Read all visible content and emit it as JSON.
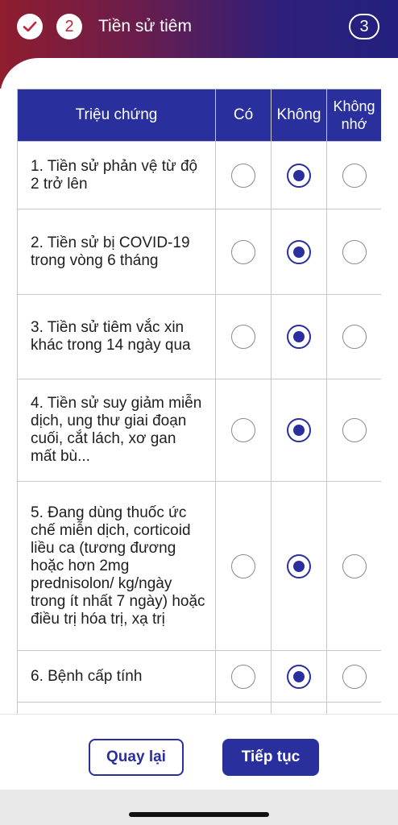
{
  "header": {
    "step_current_number": "2",
    "title": "Tiền sử tiêm",
    "step_next_number": "3"
  },
  "table": {
    "headers": {
      "symptom": "Triệu chứng",
      "yes": "Có",
      "no": "Không",
      "dont_remember": "Không nhớ"
    },
    "rows": [
      {
        "label": "1. Tiền sử phản vệ từ độ 2 trở lên",
        "selected": "no"
      },
      {
        "label": "2. Tiền sử bị COVID-19 trong vòng 6 tháng",
        "selected": "no"
      },
      {
        "label": "3. Tiền sử tiêm vắc xin khác trong 14 ngày qua",
        "selected": "no"
      },
      {
        "label": "4. Tiền sử suy giảm miễn dịch, ung thư giai đoạn cuối, cắt lách, xơ gan mất bù...",
        "selected": "no"
      },
      {
        "label": "5. Đang dùng thuốc ức chế miễn dịch, corticoid liều ca (tương đương hoặc hơn 2mg prednisolon/ kg/ngày trong ít nhất 7 ngày) hoặc điều trị hóa trị, xạ trị",
        "selected": "no"
      },
      {
        "label": "6. Bệnh cấp tính",
        "selected": "no"
      }
    ]
  },
  "footer": {
    "back_label": "Quay lại",
    "next_label": "Tiếp tục"
  },
  "colors": {
    "primary": "#2a2f9e",
    "header_red": "#8f1d2e"
  }
}
